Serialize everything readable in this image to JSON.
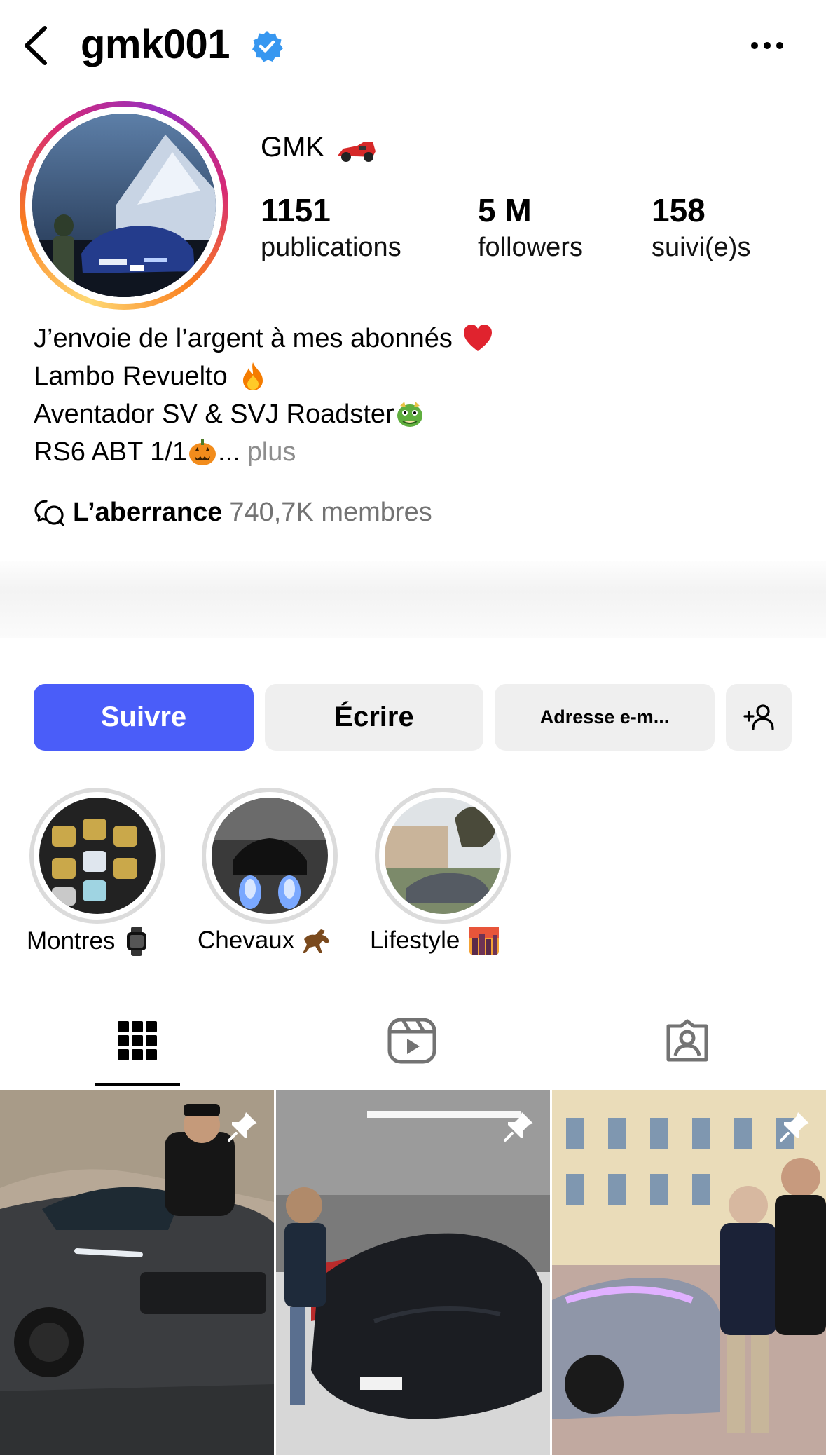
{
  "header": {
    "username": "gmk001",
    "verified": true,
    "back_icon": "chevron-left-icon",
    "more_icon": "more-horizontal-icon"
  },
  "profile": {
    "display_name": "GMK",
    "display_emoji": "racing-car-emoji",
    "stats": [
      {
        "value": "1151",
        "label": "publications"
      },
      {
        "value": "5 M",
        "label": "followers"
      },
      {
        "value": "158",
        "label": "suivi(e)s"
      }
    ],
    "bio": {
      "line1": "J’envoie de l’argent à mes abonnés",
      "line2": "Lambo Revuelto",
      "line3": "Aventador SV & SVJ Roadster",
      "line4": "RS6 ABT 1/1",
      "more_ellipsis": "...",
      "more_label": "plus"
    },
    "community": {
      "icon": "chat-bubbles-icon",
      "name": "L’aberrance",
      "members": "740,7K membres"
    }
  },
  "actions": {
    "follow": "Suivre",
    "message": "Écrire",
    "email": "Adresse e-m...",
    "add_user_icon": "add-user-icon"
  },
  "highlights": [
    {
      "label": "Montres",
      "emoji": "watch-emoji"
    },
    {
      "label": "Chevaux",
      "emoji": "horse-emoji"
    },
    {
      "label": "Lifestyle",
      "emoji": "city-sunset-emoji"
    }
  ],
  "tabs": [
    {
      "icon": "grid-icon",
      "selected": true
    },
    {
      "icon": "reels-icon",
      "selected": false
    },
    {
      "icon": "tagged-icon",
      "selected": false
    }
  ],
  "posts": [
    {
      "pinned": true,
      "icon": "pin-icon"
    },
    {
      "pinned": true,
      "icon": "pin-icon"
    },
    {
      "pinned": true,
      "icon": "pin-icon"
    }
  ],
  "colors": {
    "primary_button": "#4a5df9",
    "secondary_button": "#efefef",
    "verified_badge": "#3797f0",
    "muted_text": "#737373"
  }
}
